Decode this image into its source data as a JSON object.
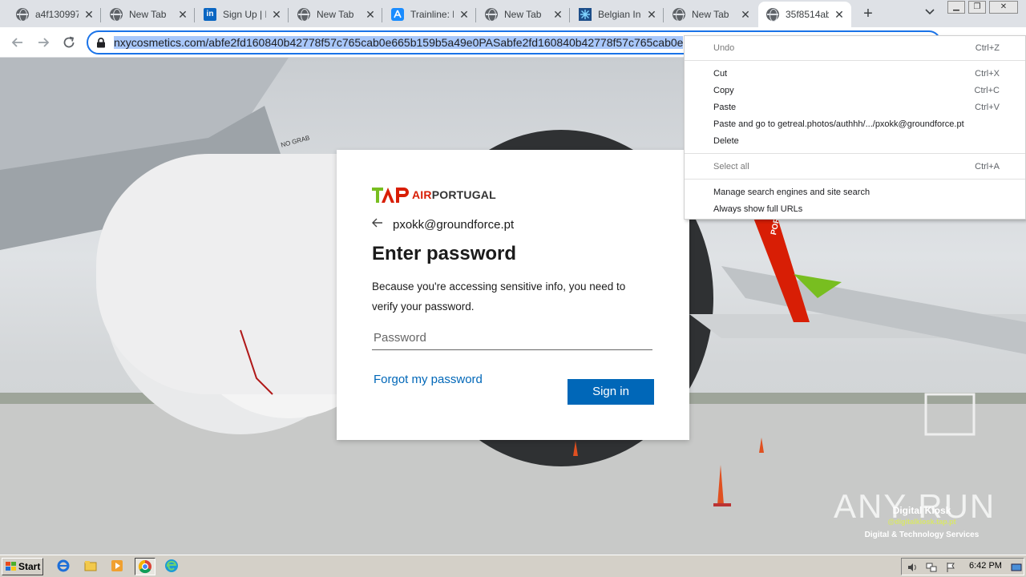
{
  "browser": {
    "tabs": [
      {
        "title": "a4f130997",
        "icon": "globe-icon",
        "active": false
      },
      {
        "title": "New Tab",
        "icon": "globe-icon",
        "active": false
      },
      {
        "title": "Sign Up | Li",
        "icon": "linkedin-icon",
        "active": false
      },
      {
        "title": "New Tab",
        "icon": "globe-icon",
        "active": false
      },
      {
        "title": "Trainline: Bu",
        "icon": "appstore-icon",
        "active": false
      },
      {
        "title": "New Tab",
        "icon": "globe-icon",
        "active": false
      },
      {
        "title": "Belgian Inc",
        "icon": "snowflake-icon",
        "active": false
      },
      {
        "title": "New Tab",
        "icon": "globe-icon",
        "active": false
      },
      {
        "title": "35f8514ab",
        "icon": "globe-icon",
        "active": true
      }
    ],
    "new_tab_symbol": "+",
    "tab_search_symbol": "⌄",
    "window_controls": [
      "minimize",
      "restore",
      "close"
    ],
    "address_bar": {
      "url": "nxycosmetics.com/abfe2fd160840b42778f57c765cab0e665b159b5a49e0PASabfe2fd160840b42778f57c765cab0e"
    }
  },
  "login": {
    "brand_text_left": "AIR",
    "brand_text_right": "PORTUGAL",
    "identity_email": "pxokk@groundforce.pt",
    "heading": "Enter password",
    "description": "Because you're accessing sensitive info, you need to verify your password.",
    "password_placeholder": "Password",
    "forgot_link": "Forgot my password",
    "signin_button": "Sign in"
  },
  "context_menu": {
    "items": [
      {
        "label": "Undo",
        "shortcut": "Ctrl+Z",
        "enabled": false
      },
      {
        "label": "Cut",
        "shortcut": "Ctrl+X",
        "enabled": true
      },
      {
        "label": "Copy",
        "shortcut": "Ctrl+C",
        "enabled": true
      },
      {
        "label": "Paste",
        "shortcut": "Ctrl+V",
        "enabled": true
      },
      {
        "label": "Paste and go to getreal.photos/authhh/.../pxokk@groundforce.pt",
        "shortcut": "",
        "enabled": true
      },
      {
        "label": "Delete",
        "shortcut": "",
        "enabled": true
      },
      {
        "label": "Select all",
        "shortcut": "Ctrl+A",
        "enabled": false
      },
      {
        "label": "Manage search engines and site search",
        "shortcut": "",
        "enabled": true
      },
      {
        "label": "Always show full URLs",
        "shortcut": "",
        "enabled": true
      }
    ]
  },
  "background": {
    "watermark": "ANY RUN",
    "kiosk_title": "Digital Kiosk",
    "kiosk_url": "@digitalkiosk.tap.pt",
    "kiosk_subtitle": "Digital & Technology Services",
    "tail_text": "PORTUGAL",
    "engine_text": "NO GRAB"
  },
  "taskbar": {
    "start_label": "Start",
    "clock": "6:42 PM",
    "quick_launch": [
      "ie-icon",
      "explorer-icon",
      "media-player-icon",
      "chrome-icon",
      "edge-icon"
    ]
  },
  "colors": {
    "accent_blue": "#0067b8",
    "omnibox_focus": "#1a73e8",
    "tap_green": "#78be20",
    "tap_red": "#d81e05"
  }
}
